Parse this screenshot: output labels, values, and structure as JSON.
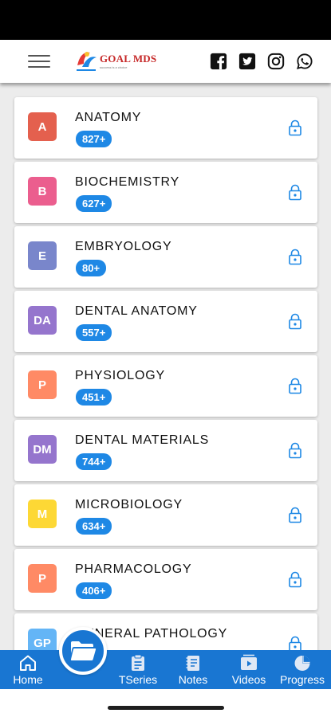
{
  "app": {
    "logo_text": "GOAL MDS",
    "logo_tagline": "success is a choice"
  },
  "header": {
    "social_icons": [
      "facebook-icon",
      "twitter-icon",
      "instagram-icon",
      "whatsapp-icon"
    ]
  },
  "subjects": [
    {
      "letter": "A",
      "name": "ANATOMY",
      "count": "827+",
      "color": "#e4604e"
    },
    {
      "letter": "B",
      "name": "BIOCHEMISTRY",
      "count": "627+",
      "color": "#eb5e8e"
    },
    {
      "letter": "E",
      "name": "EMBRYOLOGY",
      "count": "80+",
      "color": "#7986cb"
    },
    {
      "letter": "DA",
      "name": "DENTAL ANATOMY",
      "count": "557+",
      "color": "#9575cd"
    },
    {
      "letter": "P",
      "name": "PHYSIOLOGY",
      "count": "451+",
      "color": "#ff8a65"
    },
    {
      "letter": "DM",
      "name": "DENTAL MATERIALS",
      "count": "744+",
      "color": "#9575cd"
    },
    {
      "letter": "M",
      "name": "MICROBIOLOGY",
      "count": "634+",
      "color": "#fdd835"
    },
    {
      "letter": "P",
      "name": "PHARMACOLOGY",
      "count": "406+",
      "color": "#ff8a65"
    },
    {
      "letter": "GP",
      "name": "GENERAL PATHOLOGY",
      "count": "",
      "color": "#64b5f6"
    }
  ],
  "bottom_nav": {
    "home": "Home",
    "tseries": "TSeries",
    "notes": "Notes",
    "videos": "Videos",
    "progress": "Progress"
  },
  "colors": {
    "accent": "#1976d2",
    "badge": "#1e88e5"
  }
}
